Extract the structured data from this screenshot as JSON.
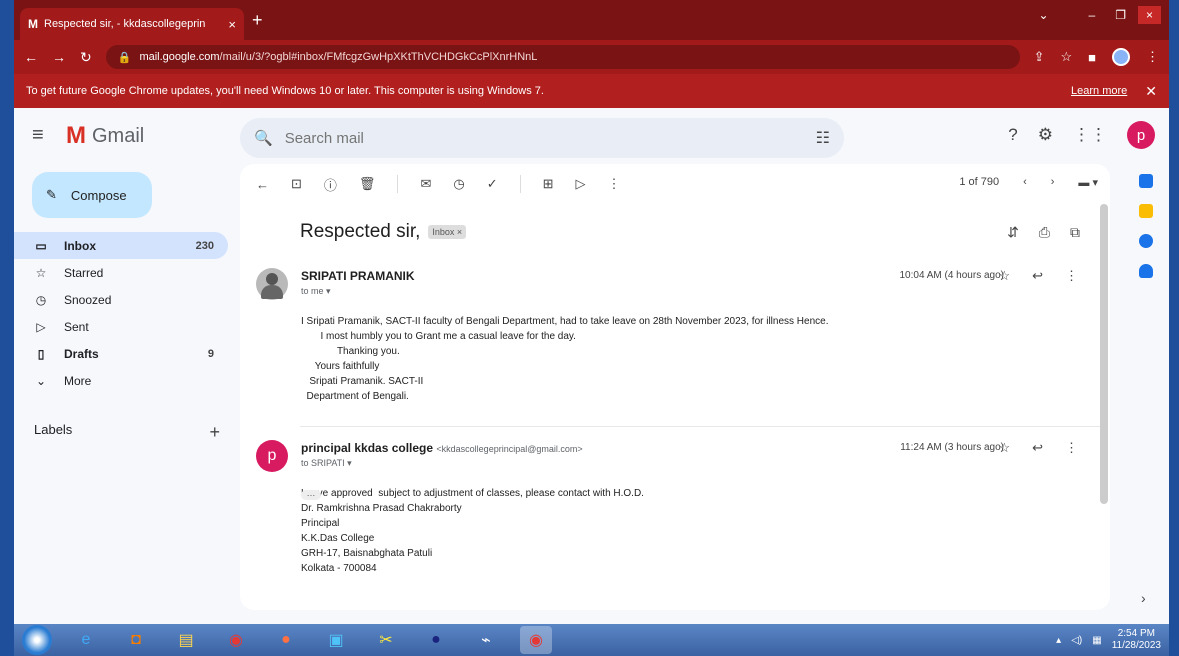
{
  "browser": {
    "tab_title": "Respected sir, - kkdascollegeprin",
    "url_domain": "mail.google.com",
    "url_path": "/mail/u/3/?ogbl#inbox/FMfcgzGwHpXKtThVCHDGkCcPlXnrHNnL",
    "info_bar_text": "To get future Google Chrome updates, you'll need Windows 10 or later. This computer is using Windows 7.",
    "learn_more": "Learn more"
  },
  "gmail": {
    "app_name": "Gmail",
    "search_placeholder": "Search mail",
    "avatar_letter": "p"
  },
  "sidebar": {
    "compose_label": "Compose",
    "items": [
      {
        "label": "Inbox",
        "count": "230"
      },
      {
        "label": "Starred",
        "count": ""
      },
      {
        "label": "Snoozed",
        "count": ""
      },
      {
        "label": "Sent",
        "count": ""
      },
      {
        "label": "Drafts",
        "count": "9"
      },
      {
        "label": "More",
        "count": ""
      }
    ],
    "labels_heading": "Labels"
  },
  "toolbar": {
    "pagination": "1 of 790"
  },
  "thread": {
    "subject": "Respected sir,",
    "badge": "Inbox ×",
    "messages": [
      {
        "sender": "SRIPATI PRAMANIK",
        "sender_email": "",
        "to": "to me ▾",
        "time": "10:04 AM (4 hours ago)",
        "lines": [
          "I Sripati Pramanik, SACT-II faculty of Bengali Department, had to take leave on 28th November 2023, for illness Hence.",
          "       I most humbly you to Grant me a casual leave for the day.",
          "             Thanking you.",
          "     Yours faithfully",
          "   Sripati Pramanik. SACT-II",
          "  Department of Bengali."
        ]
      },
      {
        "sender": "principal kkdas college",
        "sender_email": "<kkdascollegeprincipal@gmail.com>",
        "to": "to SRIPATI ▾",
        "time": "11:24 AM (3 hours ago)",
        "avatar_letter": "p",
        "lines": [
          "Leave approved  subject to adjustment of classes, please contact with H.O.D.",
          "Dr. Ramkrishna Prasad Chakraborty",
          "Principal",
          "K.K.Das College",
          "GRH-17, Baisnabghata Patuli",
          "Kolkata - 700084"
        ]
      }
    ]
  },
  "taskbar": {
    "time": "2:54 PM",
    "date": "11/28/2023"
  }
}
